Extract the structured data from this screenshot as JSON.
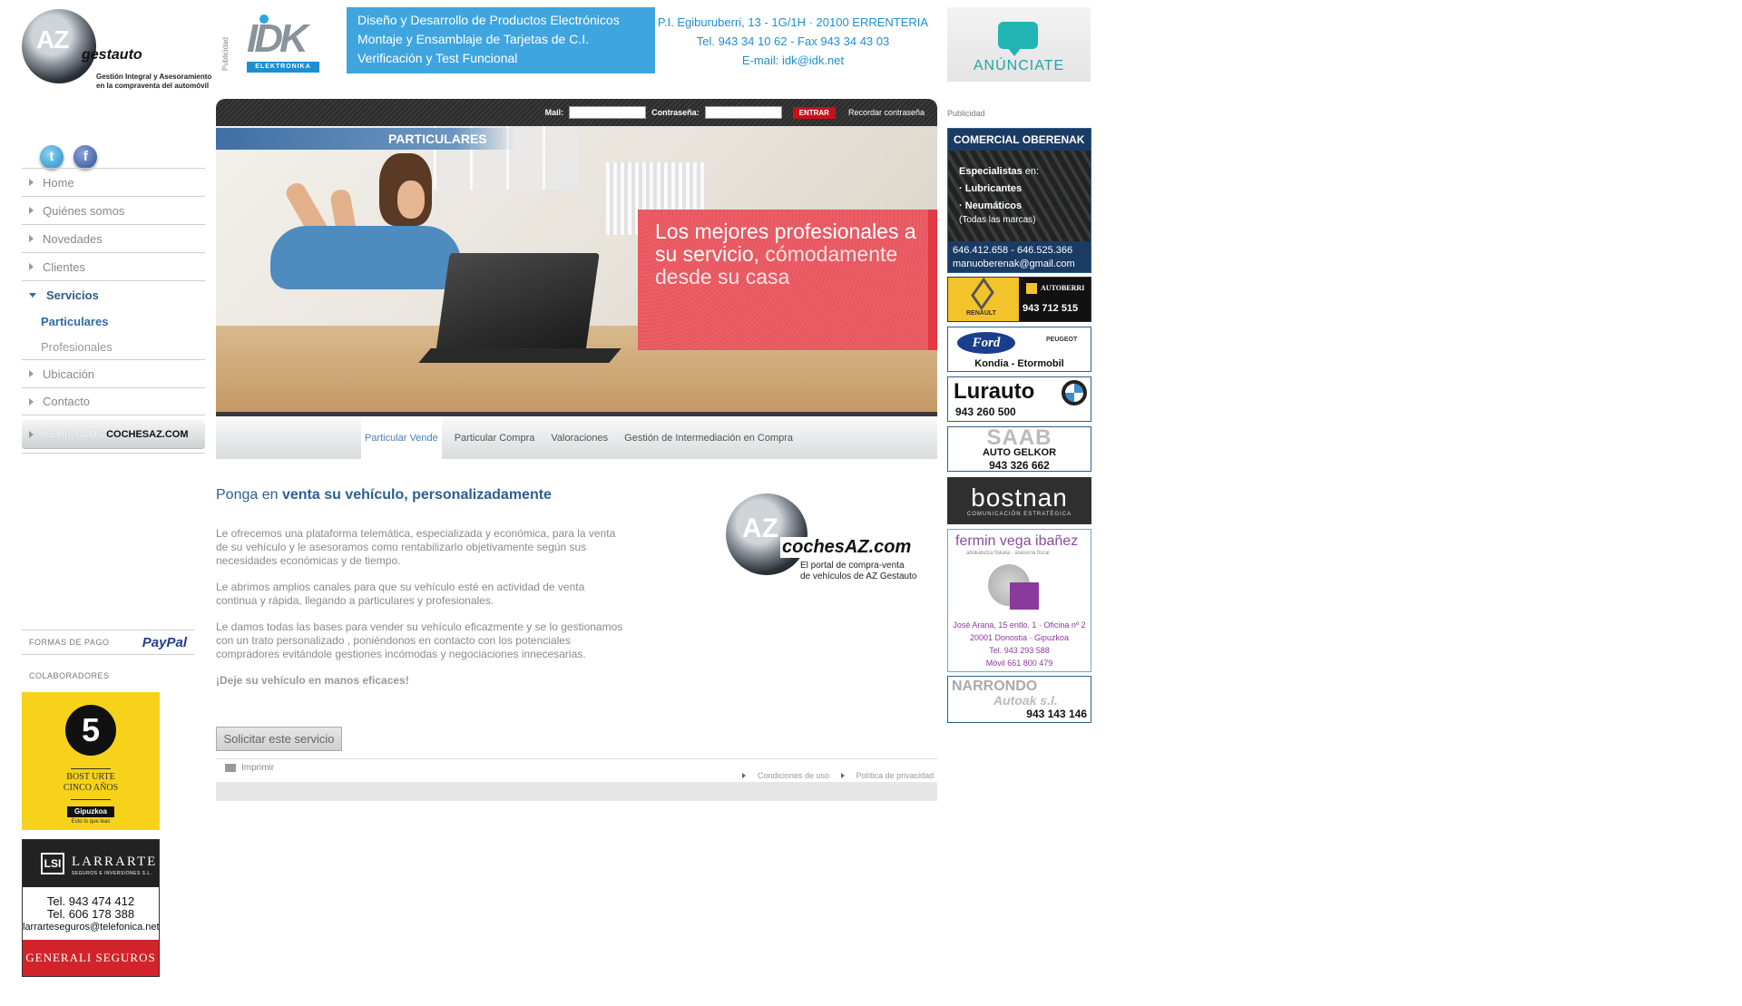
{
  "header": {
    "logo": {
      "brand_az": "AZ",
      "brand_name": "gestauto",
      "tagline_1": "Gestión Integral y Asesoramiento",
      "tagline_2": "en la compraventa del automóvil"
    },
    "publicidad_vertical": "Publicidad",
    "idk_banner": {
      "logo_text": "IDK",
      "logo_sub": "ELEKTRONIKA",
      "line_1": "Diseño y Desarrollo de Productos Electrónicos",
      "line_2": "Montaje y Ensamblaje de Tarjetas de C.I.",
      "line_3": "Verificación y Test Funcional",
      "address": "P.I. Egiburuberri, 13 - 1G/1H · 20100 ERRENTERIA",
      "phone": "Tel. 943 34 10 62 - Fax 943 34 43 03",
      "email": "E-mail: idk@idk.net"
    },
    "anunciate": "ANÚNCIATE"
  },
  "login": {
    "mail_label": "Mail:",
    "password_label": "Contraseña:",
    "mail_value": "",
    "password_value": "",
    "submit": "ENTRAR",
    "forgot": "Recordar contraseña"
  },
  "sidebar": {
    "social": {
      "twitter": "t",
      "facebook": "f"
    },
    "items": [
      {
        "label": "Home"
      },
      {
        "label": "Quiénes somos"
      },
      {
        "label": "Novedades"
      },
      {
        "label": "Clientes"
      },
      {
        "label": "Servicios"
      }
    ],
    "subitems": [
      {
        "label": "Particulares"
      },
      {
        "label": "Profesionales"
      }
    ],
    "items_after": [
      {
        "label": "Ubicación"
      },
      {
        "label": "Contacto"
      }
    ],
    "coches_button": {
      "prefix": "VEHÍCULOS",
      "brand": "COCHESAZ.COM"
    },
    "formas_pago": "FORMAS DE PAGO",
    "paypal": "PayPal",
    "colaboradores": "COLABORADORES",
    "collab_gipuzkoa": {
      "number": "5",
      "line_1": "BOST URTE",
      "line_2": "CINCO AÑOS",
      "brand": "Gipuzkoa",
      "slogan": "Esto lo que leas"
    },
    "collab_larrarte": {
      "mark": "LSI",
      "name": "LARRARTE",
      "sub": "SEGUROS E INVERSIONES S.L.",
      "tel_1": "Tel. 943 474 412",
      "tel_2": "Tel. 606 178 388",
      "email": "larrarteseguros@telefonica.net",
      "generali": "GENERALI SEGUROS"
    }
  },
  "hero": {
    "tab": "PARTICULARES",
    "headline_bold": "Los mejores profesionales a su servicio,",
    "headline_light": " cómodamente desde su casa"
  },
  "subnav": {
    "items": [
      {
        "label": "Particular Vende"
      },
      {
        "label": "Particular Compra"
      },
      {
        "label": "Valoraciones"
      },
      {
        "label": "Gestión de Intermediación en Compra"
      }
    ]
  },
  "main": {
    "title_prefix": "Ponga en ",
    "title_bold": "venta su vehículo, personalizadamente",
    "paragraphs": [
      "Le ofrecemos una plataforma telemática, especializada y económica, para la venta de su vehículo y le asesoramos como rentabilizarlo objetivamente según sus necesidades económicas y de tiempo.",
      "Le abrimos amplios canales para que su vehículo esté en actividad de venta continua y rápida, llegando a particulares y profesionales.",
      "Le damos todas las bases para vender su vehículo eficazmente y se lo gestionamos con un trato personalizado , poniéndonos en contacto con los potenciales compradores evitándole gestiones incómodas y negociaciones innecesarias."
    ],
    "closing": "¡Deje su vehículo en manos eficaces!",
    "cochesaz_logo": {
      "az": "AZ",
      "brand": "cochesAZ.com",
      "line_1": "El portal de compra-venta",
      "line_2": "de vehículos de AZ Gestauto"
    },
    "request_button": "Solicitar este servicio",
    "print": "Imprimir",
    "footer_links": [
      "Condiciones de uso",
      "Política de privacidad"
    ]
  },
  "right_ads": {
    "label": "Publicidad",
    "oberenak": {
      "header": "COMERCIAL OBERENAK",
      "line_1": "Especialistas",
      "line_1_en": " en:",
      "line_2": "· Lubricantes",
      "line_3": "· Neumáticos",
      "line_4": "(Todas las marcas)",
      "phones": "646.412.658 - 646.525.366",
      "email": "manuoberenak@gmail.com"
    },
    "renault": {
      "brand": "RENAULT",
      "dealer": "AUTOBERRI",
      "tel": "943 712 515"
    },
    "ford": {
      "ford": "Ford",
      "peugeot": "PEUGEOT",
      "name": "Kondia - Etormobil"
    },
    "lurauto": {
      "name": "Lurauto",
      "tel": "943 260 500"
    },
    "saab": {
      "brand": "SAAB",
      "name": "AUTO GELKOR",
      "tel": "943 326 662"
    },
    "bostnan": {
      "name": "bostnan",
      "sub": "COMUNICACIÓN ESTRATÉGICA"
    },
    "fermin": {
      "name": "fermin vega ibañez",
      "sub": "abokatutza fiskala · asesoría fiscal",
      "addr_1": "José Arana, 15 entlo. 1 · Oficina nº 2",
      "addr_2": "20001 Donostia · Gipuzkoa",
      "tel": "Tel.   943 293 588",
      "movil": "Móvil 661 800 479"
    },
    "narrondo": {
      "name": "NARRONDO",
      "sub": "Autoak s.l.",
      "tel": "943 143 146"
    }
  }
}
